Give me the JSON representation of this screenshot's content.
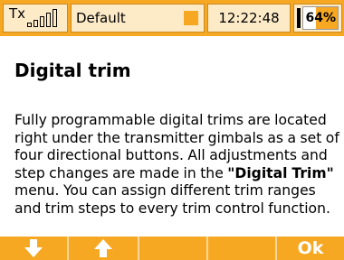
{
  "status_bar": {
    "tx_label": "Tx",
    "model_name": "Default",
    "time": "12:22:48",
    "battery_percent_text": "64%",
    "battery_level": 0.64
  },
  "content": {
    "heading": "Digital trim",
    "text_before": "Fully programmable digital trims are located right under the transmitter gimbals as a set of four directional buttons. All adjustments and step changes are made in the ",
    "menu_name": "\"Digital Trim\"",
    "text_after": " menu. You can assign different trim ranges and trim steps to every trim control function."
  },
  "toolbar": {
    "down_icon": "arrow-down-icon",
    "up_icon": "arrow-up-icon",
    "ok_label": "Ok"
  },
  "colors": {
    "accent": "#f7a823",
    "cell_bg": "#fdeac7"
  }
}
